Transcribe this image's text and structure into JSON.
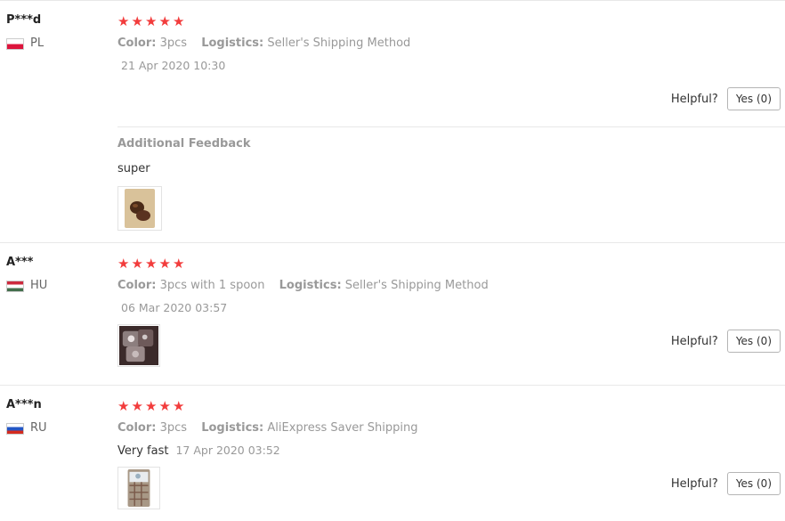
{
  "reviews": [
    {
      "user": "P***d",
      "country": "PL",
      "stars": "★★★★★",
      "color_label": "Color:",
      "color_value": "3pcs",
      "logistics_label": "Logistics:",
      "logistics_value": "Seller's Shipping Method",
      "date": "21 Apr 2020 10:30",
      "helpful_label": "Helpful?",
      "yes_label": "Yes (0)",
      "additional_title": "Additional Feedback",
      "additional_text": "super"
    },
    {
      "user": "A***",
      "country": "HU",
      "stars": "★★★★★",
      "color_label": "Color:",
      "color_value": "3pcs with 1 spoon",
      "logistics_label": "Logistics:",
      "logistics_value": "Seller's Shipping Method",
      "date": "06 Mar 2020 03:57",
      "helpful_label": "Helpful?",
      "yes_label": "Yes (0)"
    },
    {
      "user": "A***n",
      "country": "RU",
      "stars": "★★★★★",
      "color_label": "Color:",
      "color_value": "3pcs",
      "logistics_label": "Logistics:",
      "logistics_value": "AliExpress Saver Shipping",
      "text": "Very fast",
      "date": "17 Apr 2020 03:52",
      "helpful_label": "Helpful?",
      "yes_label": "Yes (0)"
    }
  ],
  "colors": {
    "star": "#f23c3c",
    "muted": "#999999",
    "text": "#333333",
    "border": "#e8e8e8"
  }
}
